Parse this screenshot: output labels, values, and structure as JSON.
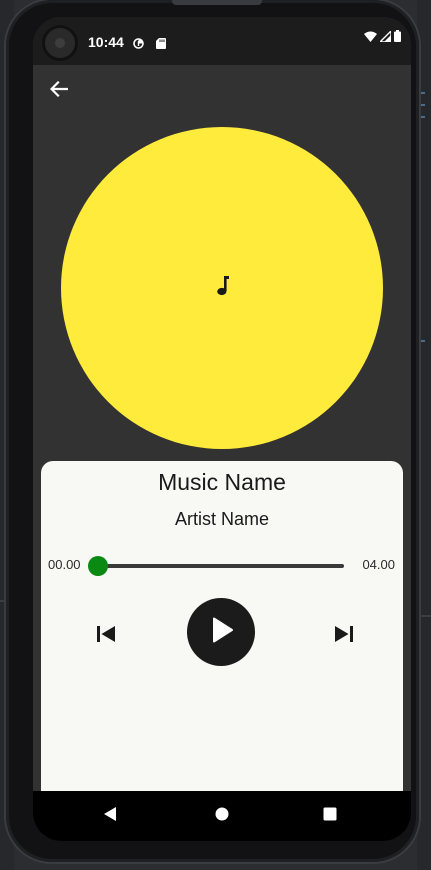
{
  "status_bar": {
    "time": "10:44",
    "left_icons": [
      "data-saver-icon",
      "sd-card-icon"
    ],
    "right_icons": [
      "wifi-icon",
      "signal-icon",
      "battery-icon"
    ]
  },
  "app_bar": {
    "back_icon": "arrow-left-icon"
  },
  "album_art": {
    "icon": "music-note-icon",
    "color": "#ffeb3b"
  },
  "player": {
    "title": "Music Name",
    "artist": "Artist Name",
    "current_time": "00.00",
    "total_time": "04.00",
    "progress": 0.0,
    "accent_color": "#0a8a12",
    "sheet_color": "#f8f8f4",
    "controls": {
      "previous_icon": "skip-previous-icon",
      "play_icon": "play-icon",
      "next_icon": "skip-next-icon"
    }
  },
  "nav_bar": {
    "icons": [
      "back-triangle-icon",
      "home-circle-icon",
      "recents-square-icon"
    ]
  }
}
